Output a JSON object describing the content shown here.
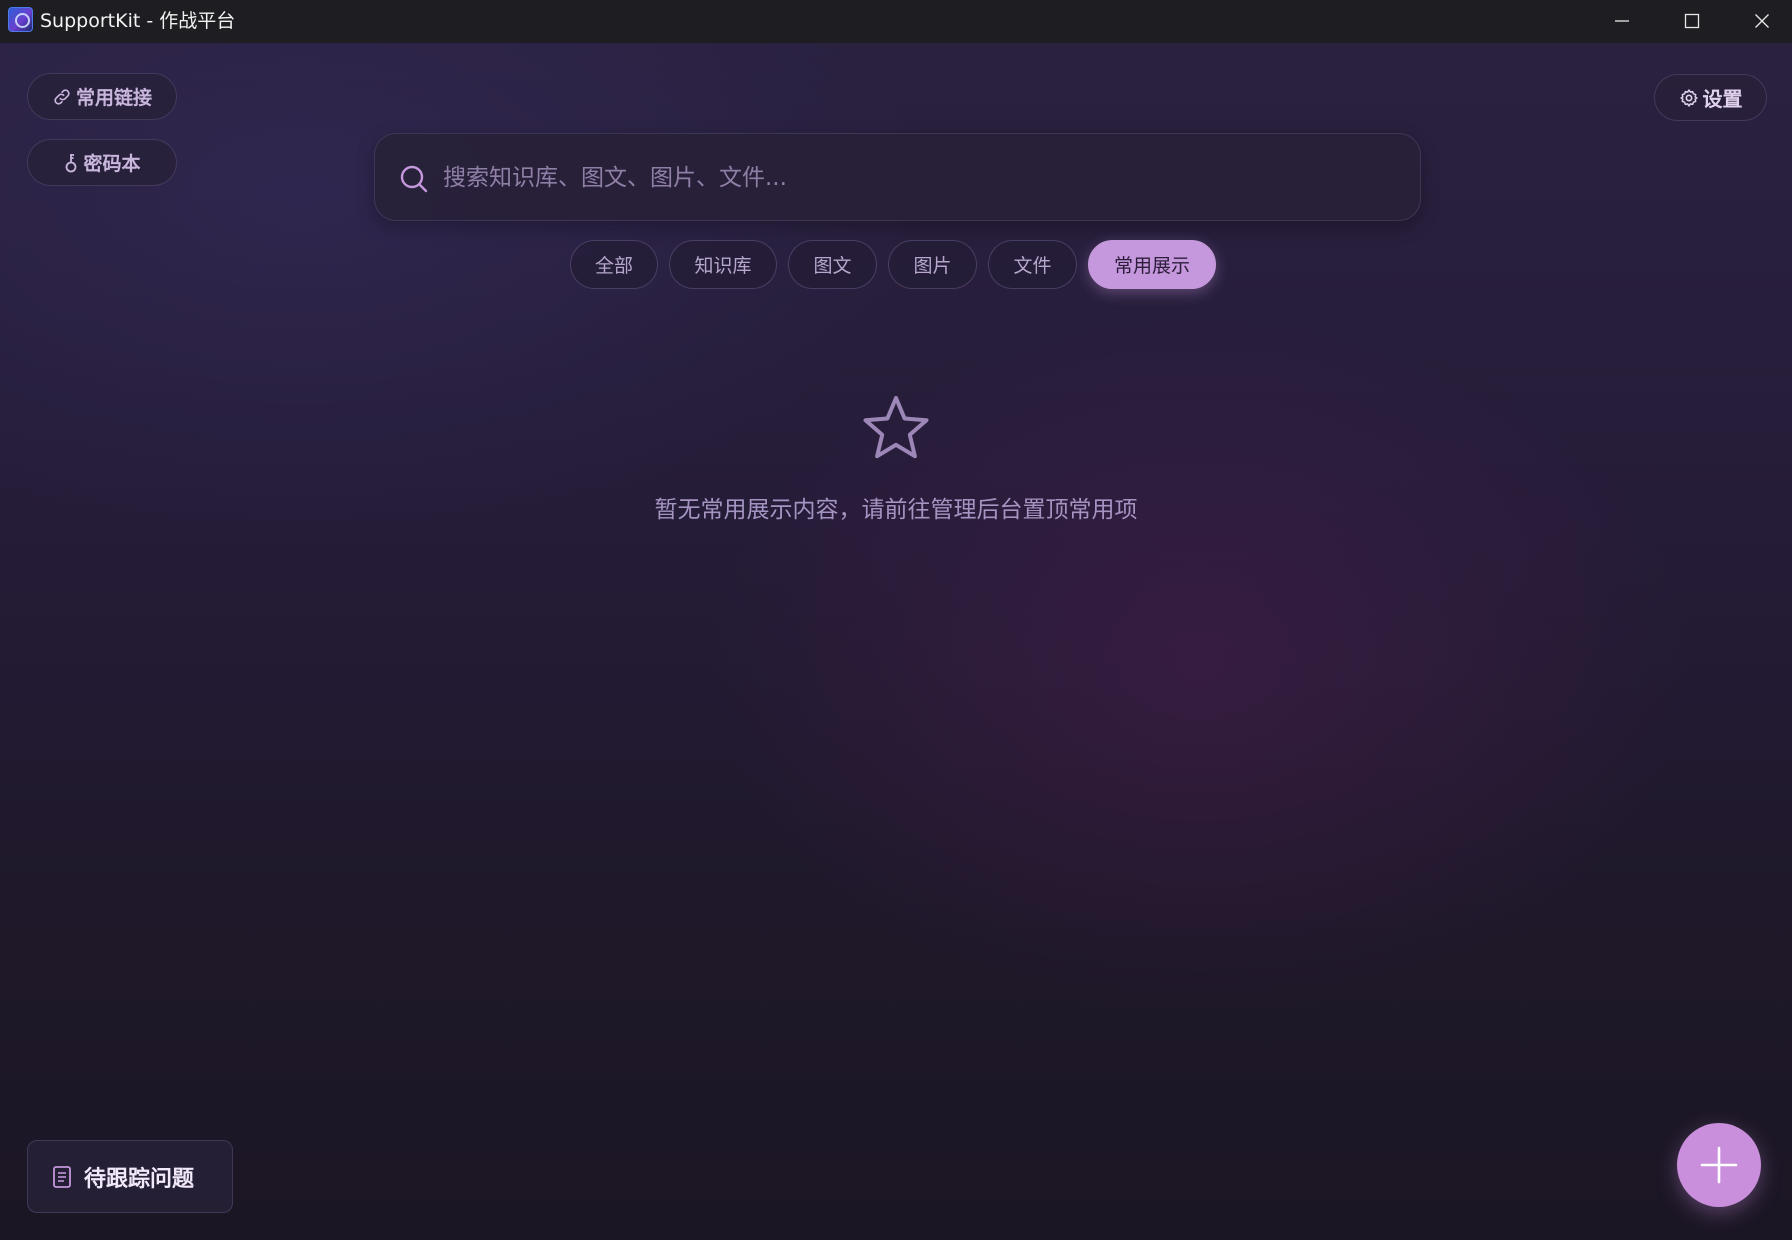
{
  "window": {
    "title": "SupportKit - 作战平台",
    "logo_icon": "app-logo-icon"
  },
  "toolbar": {
    "links_label": "常用链接",
    "links_icon": "link-icon",
    "password_label": "密码本",
    "password_icon": "key-icon",
    "settings_label": "设置",
    "settings_icon": "gear-icon"
  },
  "search": {
    "placeholder": "搜索知识库、图文、图片、文件...",
    "value": ""
  },
  "tabs": [
    {
      "label": "全部",
      "active": false
    },
    {
      "label": "知识库",
      "active": false
    },
    {
      "label": "图文",
      "active": false
    },
    {
      "label": "图片",
      "active": false
    },
    {
      "label": "文件",
      "active": false
    },
    {
      "label": "常用展示",
      "active": true
    }
  ],
  "empty_state": {
    "icon": "star-icon",
    "message": "暂无常用展示内容，请前往管理后台置顶常用项"
  },
  "pending": {
    "label": "待跟踪问题",
    "icon": "document-icon"
  },
  "fab": {
    "icon": "plus-icon"
  },
  "colors": {
    "accent": "#c597dc",
    "background": "#251c38",
    "text_muted": "#a594c2"
  }
}
